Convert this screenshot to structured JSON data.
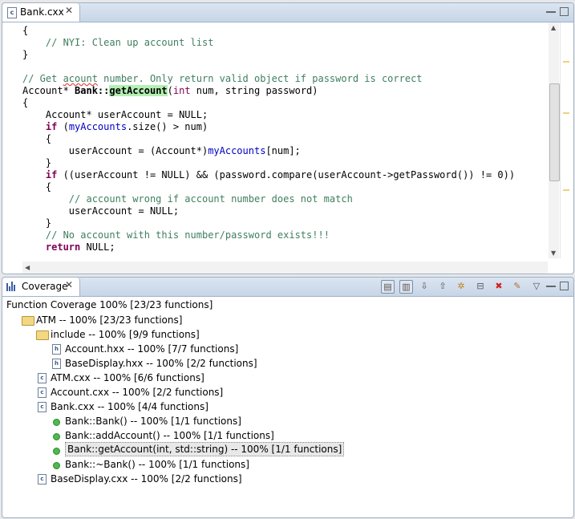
{
  "editor": {
    "tab_label": "Bank.cxx",
    "tab_icon": "c",
    "code_lines": [
      [
        {
          "t": "{",
          "c": "id"
        }
      ],
      [
        {
          "t": "    ",
          "c": "id"
        },
        {
          "t": "// NYI: Clean up account list",
          "c": "cm"
        }
      ],
      [
        {
          "t": "}",
          "c": "id"
        }
      ],
      [
        {
          "t": "",
          "c": "id"
        }
      ],
      [
        {
          "t": "// Get ",
          "c": "cm"
        },
        {
          "t": "acount",
          "c": "cm squiggle"
        },
        {
          "t": " number. Only return valid object if password is correct",
          "c": "cm"
        }
      ],
      [
        {
          "t": "Account* ",
          "c": "id"
        },
        {
          "t": "Bank::",
          "c": "id bold"
        },
        {
          "t": "getAccount",
          "c": "fn-hl"
        },
        {
          "t": "(",
          "c": "id"
        },
        {
          "t": "int",
          "c": "kw"
        },
        {
          "t": " num, string password)",
          "c": "id"
        }
      ],
      [
        {
          "t": "{",
          "c": "id"
        }
      ],
      [
        {
          "t": "    Account* userAccount = NULL;",
          "c": "id"
        }
      ],
      [
        {
          "t": "    ",
          "c": "id"
        },
        {
          "t": "if",
          "c": "kw bold"
        },
        {
          "t": " (",
          "c": "id"
        },
        {
          "t": "myAccounts",
          "c": "fld"
        },
        {
          "t": ".size() > num)",
          "c": "id"
        }
      ],
      [
        {
          "t": "    {",
          "c": "id"
        }
      ],
      [
        {
          "t": "        userAccount = (Account*)",
          "c": "id"
        },
        {
          "t": "myAccounts",
          "c": "fld"
        },
        {
          "t": "[num];",
          "c": "id"
        }
      ],
      [
        {
          "t": "    }",
          "c": "id"
        }
      ],
      [
        {
          "t": "    ",
          "c": "id"
        },
        {
          "t": "if",
          "c": "kw bold"
        },
        {
          "t": " ((userAccount != NULL) && (password.compare(userAccount->getPassword()) != 0))",
          "c": "id"
        }
      ],
      [
        {
          "t": "    {",
          "c": "id"
        }
      ],
      [
        {
          "t": "        ",
          "c": "id"
        },
        {
          "t": "// account wrong if account number does not match",
          "c": "cm"
        }
      ],
      [
        {
          "t": "        userAccount = NULL;",
          "c": "id"
        }
      ],
      [
        {
          "t": "    }",
          "c": "id"
        }
      ],
      [
        {
          "t": "    ",
          "c": "id"
        },
        {
          "t": "// No account with this number/password exists!!!",
          "c": "cm"
        }
      ],
      [
        {
          "t": "    ",
          "c": "id"
        },
        {
          "t": "return",
          "c": "kw bold"
        },
        {
          "t": " NULL;",
          "c": "id"
        }
      ]
    ]
  },
  "coverage": {
    "tab_label": "Coverage",
    "summary": "Function Coverage 100% [23/23 functions]",
    "toolbar": [
      {
        "name": "show-functions-button",
        "glyph": "▤",
        "pressed": true
      },
      {
        "name": "show-lines-button",
        "glyph": "▥",
        "pressed": true
      },
      {
        "name": "next-button",
        "glyph": "⇩",
        "pressed": false
      },
      {
        "name": "previous-button",
        "glyph": "⇧",
        "pressed": false
      },
      {
        "name": "settings-button",
        "glyph": "✲",
        "pressed": false
      },
      {
        "name": "collapse-all-button",
        "glyph": "⊟",
        "pressed": false
      },
      {
        "name": "remove-button",
        "glyph": "✖",
        "pressed": false
      },
      {
        "name": "pin-button",
        "glyph": "✎",
        "pressed": false
      },
      {
        "name": "view-menu-button",
        "glyph": "▽",
        "pressed": false
      }
    ],
    "tree": [
      {
        "level": 0,
        "icon": "folder",
        "text": "ATM -- 100% [23/23 functions]"
      },
      {
        "level": 1,
        "icon": "folder",
        "text": "include -- 100% [9/9 functions]"
      },
      {
        "level": 2,
        "icon": "h",
        "text": "Account.hxx -- 100% [7/7 functions]"
      },
      {
        "level": 2,
        "icon": "h",
        "text": "BaseDisplay.hxx -- 100% [2/2 functions]"
      },
      {
        "level": 1,
        "icon": "c",
        "text": "ATM.cxx -- 100% [6/6 functions]"
      },
      {
        "level": 1,
        "icon": "c",
        "text": "Account.cxx -- 100% [2/2 functions]"
      },
      {
        "level": 1,
        "icon": "c",
        "text": "Bank.cxx -- 100% [4/4 functions]"
      },
      {
        "level": 2,
        "icon": "dot",
        "text": "Bank::Bank() -- 100% [1/1 functions]"
      },
      {
        "level": 2,
        "icon": "dot",
        "text": "Bank::addAccount() -- 100% [1/1 functions]"
      },
      {
        "level": 2,
        "icon": "dot",
        "text": "Bank::getAccount(int, std::string) -- 100% [1/1 functions]",
        "selected": true
      },
      {
        "level": 2,
        "icon": "dot",
        "text": "Bank::~Bank() -- 100% [1/1 functions]"
      },
      {
        "level": 1,
        "icon": "c",
        "text": "BaseDisplay.cxx -- 100% [2/2 functions]"
      }
    ]
  }
}
